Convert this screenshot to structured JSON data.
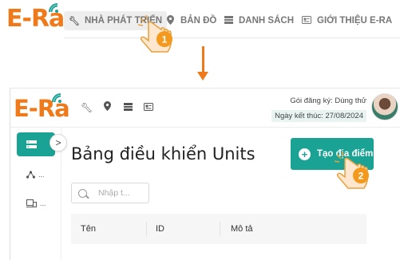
{
  "top_nav": {
    "logo_text": "E-Ra",
    "items": [
      {
        "label": "NHÀ PHÁT TRIỂN",
        "icon": "wrench-icon",
        "active": true
      },
      {
        "label": "BẢN ĐỒ",
        "icon": "map-pin-icon",
        "active": false
      },
      {
        "label": "DANH SÁCH",
        "icon": "list-icon",
        "active": false
      },
      {
        "label": "GIỚI THIỆU E-RA",
        "icon": "info-card-icon",
        "active": false
      }
    ]
  },
  "app": {
    "logo_text": "E-Ra",
    "header_icons": [
      "wrench-icon",
      "map-pin-icon",
      "list-icon",
      "info-card-icon"
    ],
    "plan_label": "Gói đăng ký:",
    "plan_value": "Dùng thử",
    "expiry_label": "Ngày kết thúc:",
    "expiry_value": "27/08/2024",
    "sidebar": [
      {
        "icon": "dashboard-icon",
        "label": "",
        "active": true
      },
      {
        "icon": "network-icon",
        "label": "...",
        "active": false
      },
      {
        "icon": "devices-icon",
        "label": "...",
        "active": false
      }
    ],
    "collapse_glyph": ">",
    "page_title": "Bảng điều khiển Units",
    "add_button_label": "Tạo địa điểm",
    "search_placeholder": "Nhập t...",
    "table_columns": [
      "Tên",
      "ID",
      "Mô tả"
    ]
  },
  "step_badges": [
    "1",
    "2"
  ],
  "colors": {
    "brand_orange": "#f07a1a",
    "accent_teal": "#1aa394",
    "badge_orange": "#f39a1e"
  }
}
